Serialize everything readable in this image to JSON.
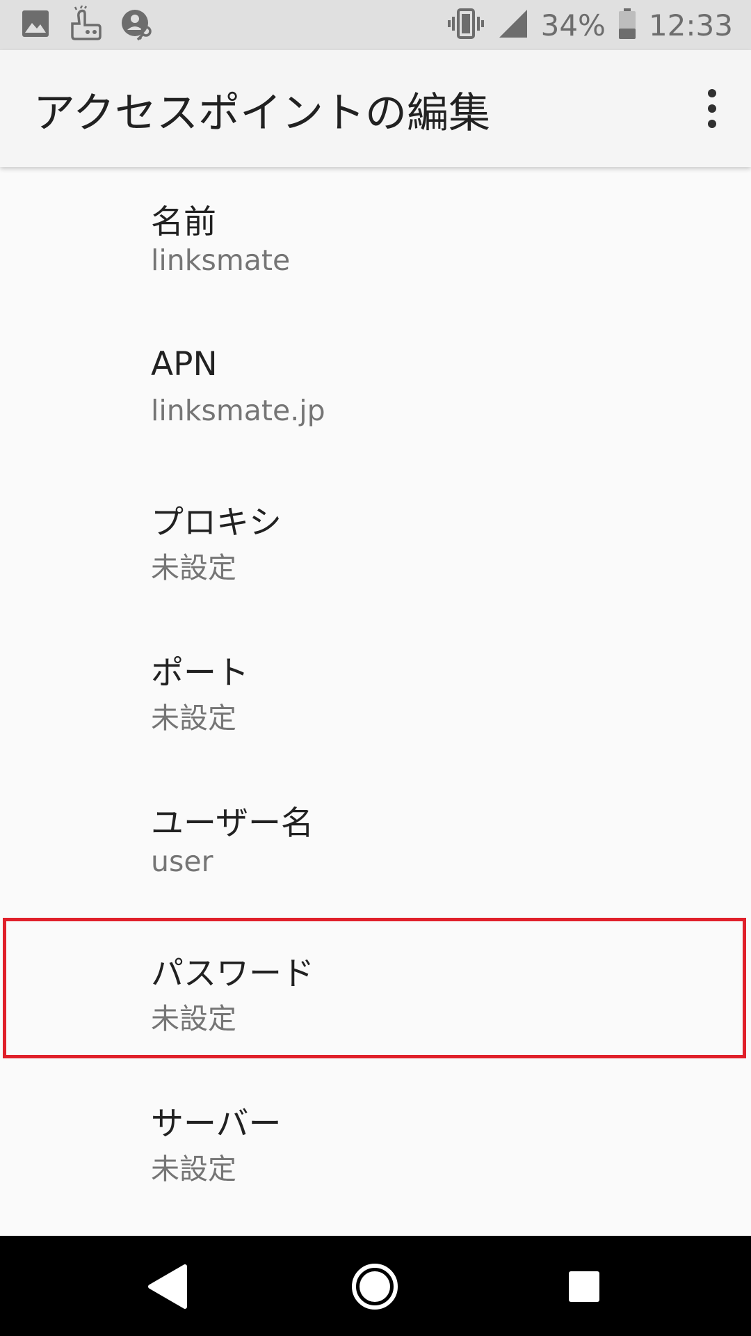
{
  "status_bar": {
    "left_icons": [
      "image-icon",
      "mascot-app-icon",
      "person-key-icon"
    ],
    "right_icons": [
      "vibrate-icon",
      "signal-icon",
      "battery-icon"
    ],
    "battery": "34%",
    "time": "12:33"
  },
  "app_bar": {
    "title": "アクセスポイントの編集",
    "menu_icon": "more-vert-icon"
  },
  "preferences": [
    {
      "title": "名前",
      "summary": "linksmate"
    },
    {
      "title": "APN",
      "summary": "linksmate.jp"
    },
    {
      "title": "プロキシ",
      "summary": "未設定"
    },
    {
      "title": "ポート",
      "summary": "未設定"
    },
    {
      "title": "ユーザー名",
      "summary": "user"
    },
    {
      "title": "パスワード",
      "summary": "未設定",
      "highlighted": true
    },
    {
      "title": "サーバー",
      "summary": "未設定"
    }
  ],
  "nav_bar": {
    "icons": [
      "back-icon",
      "home-icon",
      "recents-icon"
    ]
  },
  "colors": {
    "status_bar_bg": "#e0e0e0",
    "app_bar_bg": "#f5f5f5",
    "list_bg": "#fafafa",
    "highlight": "#e0202a",
    "nav_bar_bg": "#000000"
  }
}
